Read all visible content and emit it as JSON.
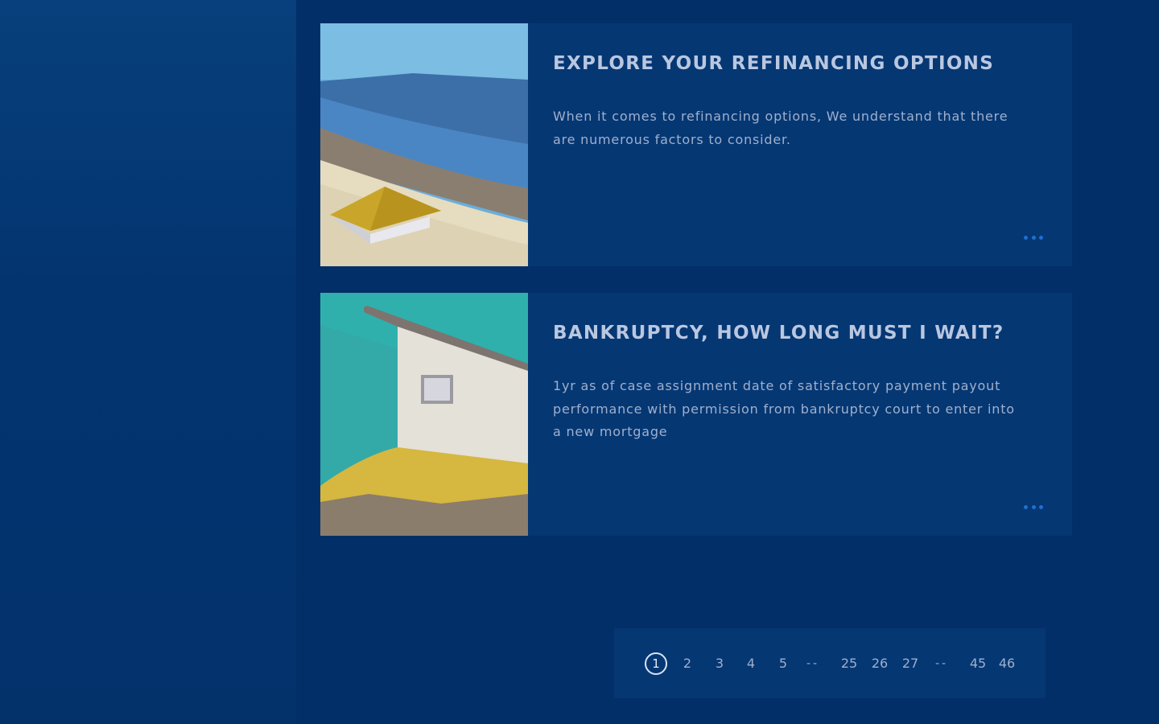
{
  "colors": {
    "background": "#032f68",
    "card": "#053773",
    "title": "#b9c7e0",
    "text": "#9fb0cd",
    "accent_dots": "#1f6fd0"
  },
  "cards": [
    {
      "title": "EXPLORE YOUR REFINANCING OPTIONS",
      "text": "When it comes to refinancing options, We understand that there are numerous factors to consider.",
      "more_label": "•••",
      "image_icon": "beach-house-illustration"
    },
    {
      "title": "BANKRUPTCY, HOW LONG MUST I WAIT?",
      "text": "1yr as of case assignment date of satisfactory payment payout performance with permission from bankruptcy court to enter into a new mortgage",
      "more_label": "•••",
      "image_icon": "house-wall-illustration"
    }
  ],
  "pagination": {
    "current": "1",
    "items": [
      "1",
      "2",
      "3",
      "4",
      "5",
      "--",
      "25",
      "26",
      "27",
      "--",
      "45",
      "46"
    ]
  }
}
